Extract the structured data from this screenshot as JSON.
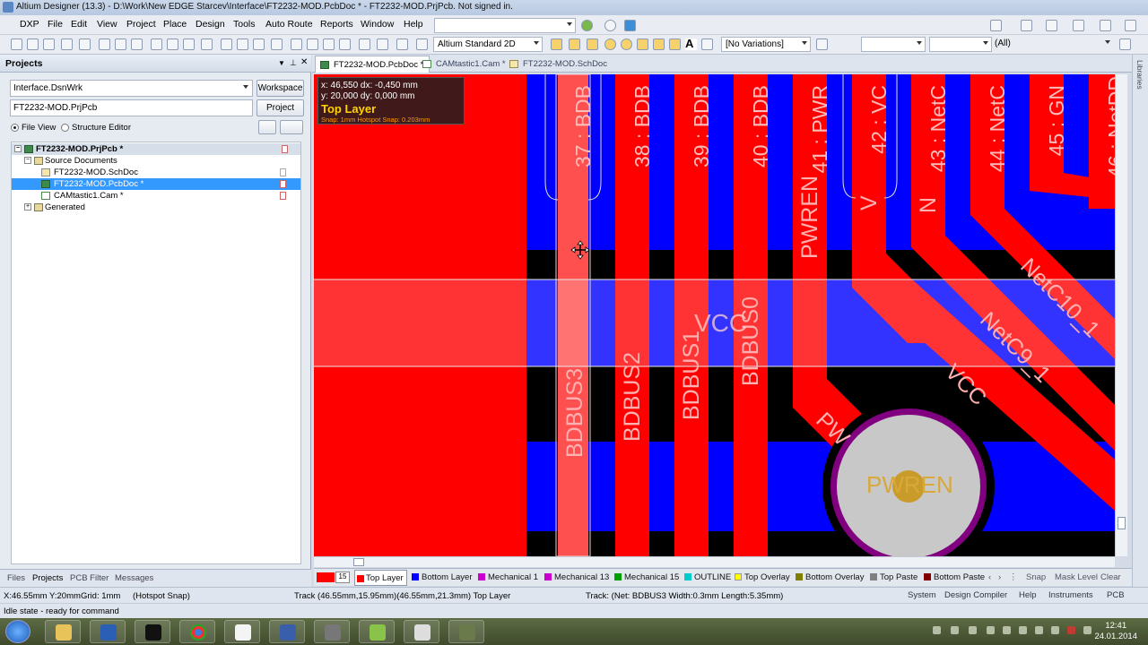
{
  "window": {
    "title": "Altium Designer (13.3) - D:\\Work\\New EDGE Starcev\\Interface\\FT2232-MOD.PcbDoc * - FT2232-MOD.PrjPcb. Not signed in."
  },
  "menu": [
    "DXP",
    "File",
    "Edit",
    "View",
    "Project",
    "Place",
    "Design",
    "Tools",
    "Auto Route",
    "Reports",
    "Window",
    "Help"
  ],
  "toolbar": {
    "view_mode": "Altium Standard 2D",
    "variations": "[No Variations]",
    "filter_scope": "(All)"
  },
  "projects_panel": {
    "title": "Projects",
    "workspace_value": "Interface.DsnWrk",
    "workspace_button": "Workspace",
    "project_value": "FT2232-MOD.PrjPcb",
    "project_button": "Project",
    "view_file": "File View",
    "view_structure": "Structure Editor",
    "tree": [
      {
        "label": "FT2232-MOD.PrjPcb *",
        "level": 0,
        "kind": "project"
      },
      {
        "label": "Source Documents",
        "level": 1,
        "kind": "folder"
      },
      {
        "label": "FT2232-MOD.SchDoc",
        "level": 2,
        "kind": "sch"
      },
      {
        "label": "FT2232-MOD.PcbDoc *",
        "level": 2,
        "kind": "pcb"
      },
      {
        "label": "CAMtastic1.Cam *",
        "level": 2,
        "kind": "cam"
      },
      {
        "label": "Generated",
        "level": 1,
        "kind": "folder"
      }
    ],
    "bottom_tabs": [
      "Files",
      "Projects",
      "PCB Filter",
      "Messages"
    ]
  },
  "doc_tabs": [
    "FT2232-MOD.PcbDoc *",
    "CAMtastic1.Cam *",
    "FT2232-MOD.SchDoc"
  ],
  "hud": {
    "line1": "x: 46,550   dx: -0,450 mm",
    "line2": "y: 20,000   dy:  0,000 mm",
    "layer": "Top Layer",
    "snap": "Snap: 1mm Hotspot Snap: 0.203mm"
  },
  "pcb_labels": {
    "pads": [
      "37 : BDB",
      "38 : BDB",
      "39 : BDB",
      "40 : BDB",
      "41 : PWR",
      "42 : VC",
      "43 : NetC",
      "44 : NetC",
      "45 : GN",
      "46 : NetDD"
    ],
    "nets": [
      "BDBUS3",
      "BDBUS2",
      "BDBUS1",
      "BDBUS0",
      "PWREN",
      "V",
      "N",
      "VCC",
      "NetC10_1",
      "NetC9_1",
      "VCC",
      "PW"
    ],
    "via": "PWREN"
  },
  "colors": {
    "top_layer": "#ff0000",
    "bottom_layer": "#0000ff",
    "mechanical1": "#cc00cc",
    "mechanical13": "#cc00cc",
    "mechanical15": "#00a000",
    "outline": "#00cccc",
    "top_overlay": "#ffff00",
    "bottom_overlay": "#808000",
    "top_paste": "#808080",
    "bottom_paste": "#800000",
    "via_ring": "#800080",
    "via_label": "#c89b2a"
  },
  "layer_tabs": {
    "current_number": "15",
    "layers": [
      "Top Layer",
      "Bottom Layer",
      "Mechanical 1",
      "Mechanical 13",
      "Mechanical 15",
      "OUTLINE",
      "Top Overlay",
      "Bottom Overlay",
      "Top Paste",
      "Bottom Paste"
    ],
    "right_buttons": [
      "Snap",
      "Mask Level",
      "Clear"
    ]
  },
  "status": {
    "coords": "X:46.55mm Y:20mm",
    "grid": "Grid: 1mm",
    "snap": "(Hotspot Snap)",
    "track_info": "Track (46.55mm,15.95mm)(46.55mm,21.3mm)  Top Layer",
    "net_info": "Track: (Net: BDBUS3 Width:0.3mm Length:5.35mm)",
    "panels": [
      "System",
      "Design Compiler",
      "Help",
      "Instruments",
      "PCB"
    ],
    "state": "Idle state - ready for command"
  },
  "rail_label": "Libraries",
  "taskbar": {
    "time": "12:41",
    "date": "24.01.2014"
  }
}
